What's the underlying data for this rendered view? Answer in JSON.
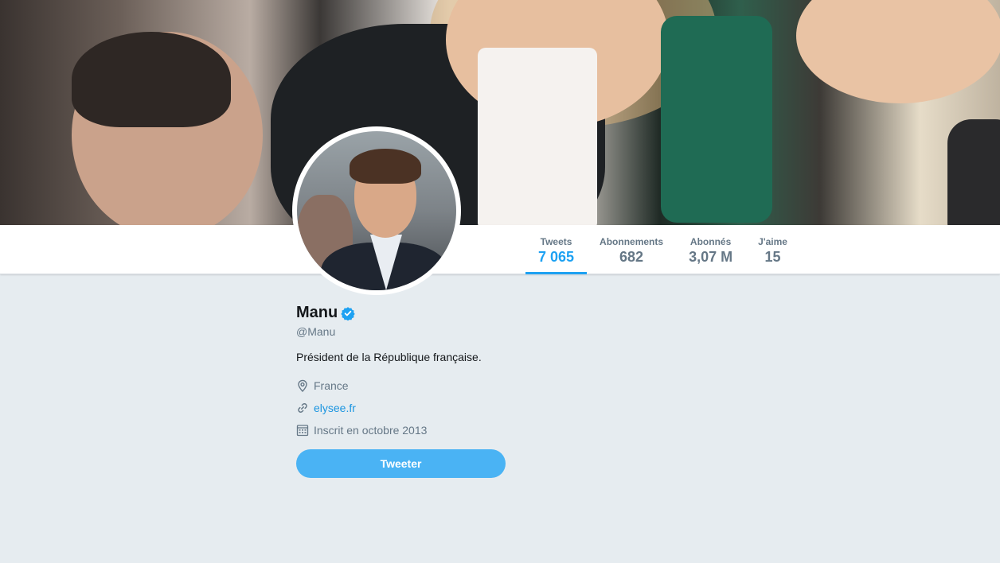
{
  "stats": [
    {
      "label": "Tweets",
      "value": "7 065",
      "active": true
    },
    {
      "label": "Abonnements",
      "value": "682",
      "active": false
    },
    {
      "label": "Abonnés",
      "value": "3,07 M",
      "active": false
    },
    {
      "label": "J'aime",
      "value": "15",
      "active": false
    }
  ],
  "profile": {
    "name": "Manu",
    "handle": "@Manu",
    "bio": "Président de la République française.",
    "location": "France",
    "website": "elysee.fr",
    "joined": "Inscrit en octobre 2013"
  },
  "tweet_button_label": "Tweeter",
  "icons": {
    "verified": "verified-badge-icon",
    "location": "location-pin-icon",
    "website": "link-icon",
    "joined": "calendar-icon"
  },
  "colors": {
    "accent": "#1da1f2",
    "button": "#4ab3f4",
    "link": "#1b95e0",
    "muted": "#657786",
    "background": "#e6ecf0"
  }
}
